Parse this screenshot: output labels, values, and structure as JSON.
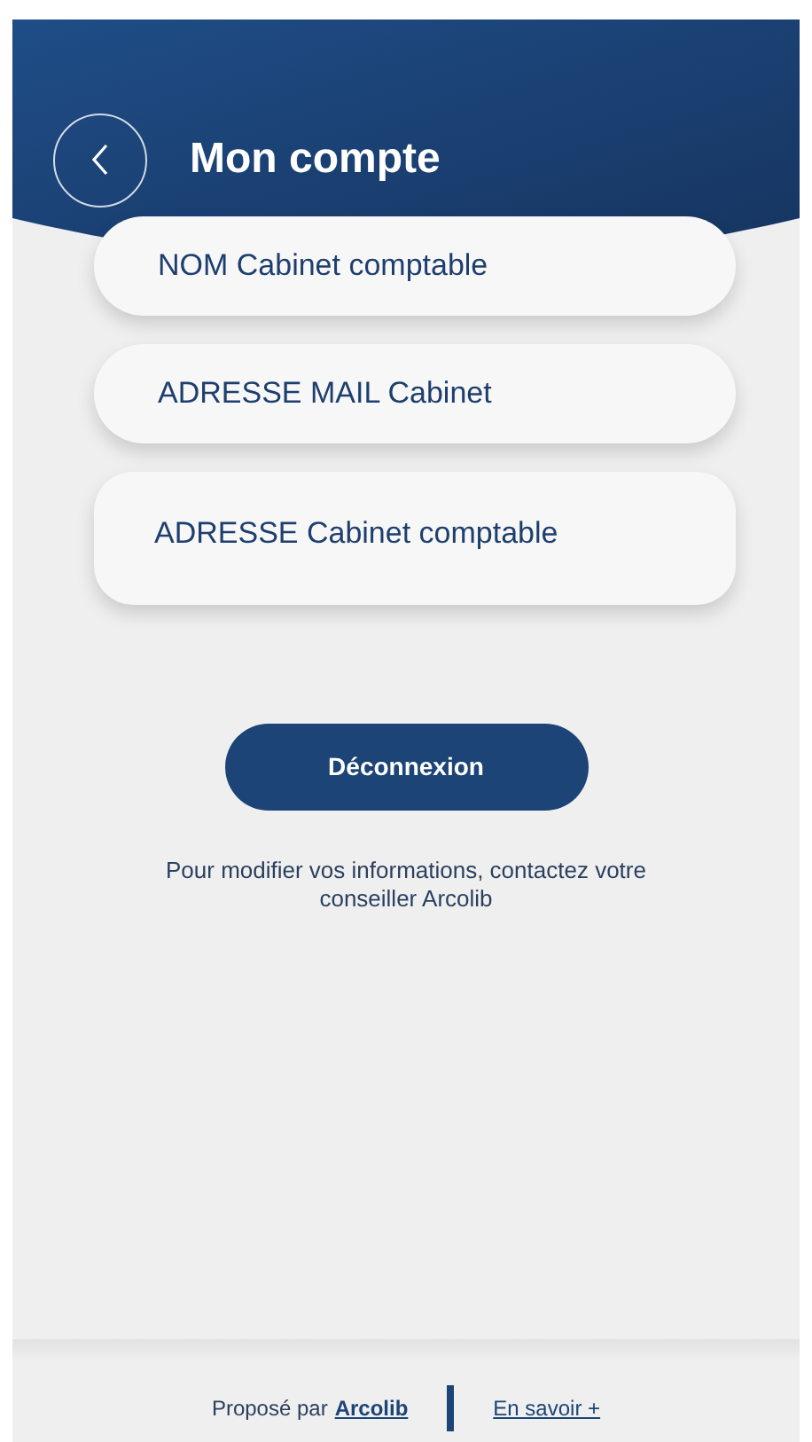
{
  "header": {
    "title": "Mon compte"
  },
  "fields": [
    {
      "value": "NOM Cabinet comptable"
    },
    {
      "value": "ADRESSE MAIL Cabinet"
    },
    {
      "value": "ADRESSE Cabinet comptable"
    }
  ],
  "logout_button": {
    "label": "Déconnexion"
  },
  "note": "Pour modifier vos informations, contactez votre conseiller Arcolib",
  "footer": {
    "proposed_by": "Proposé par",
    "brand_link": "Arcolib",
    "more_link": "En savoir +"
  }
}
